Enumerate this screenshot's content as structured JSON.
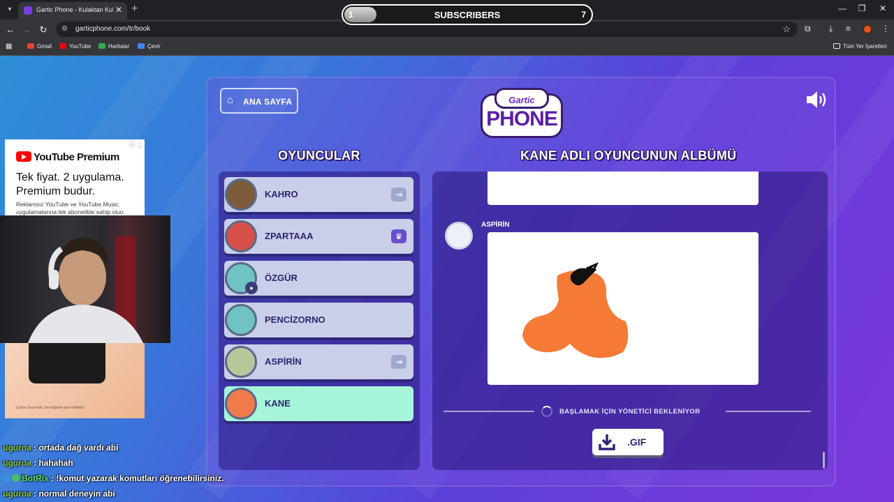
{
  "browser": {
    "tab_title": "Gartic Phone - Kulaktan Kulağa",
    "url": "garticphone.com/tr/book",
    "bookmarks": [
      "Gmail",
      "YouTube",
      "Haritalar",
      "Çevir"
    ],
    "all_bookmarks": "Tüm Yer İşaretleri"
  },
  "subscriber_goal": {
    "start": "1",
    "label": "SUBSCRIBERS",
    "end": "7"
  },
  "game": {
    "home_label": "ANA SAYFA",
    "logo_top": "Gartic",
    "logo_bottom": "PHONE",
    "players_heading": "OYUNCULAR",
    "album_heading": "KANE ADLI OYUNCUNUN ALBÜMÜ",
    "players": [
      {
        "name": "KAHRO",
        "badge": "exit"
      },
      {
        "name": "ZPARTAAA",
        "badge": "crown"
      },
      {
        "name": "ÖZGÜR",
        "badge": ""
      },
      {
        "name": "PENCİZORNO",
        "badge": ""
      },
      {
        "name": "ASPİRİN",
        "badge": "exit"
      },
      {
        "name": "KANE",
        "badge": "",
        "active": true
      }
    ],
    "drawing_author": "ASPİRİN",
    "waiting_text": "BAŞLAMAK İÇİN YÖNETİCİ BEKLENİYOR",
    "gif_label": ".GIF"
  },
  "ad": {
    "brand": "YouTube Premium",
    "headline": "Tek fiyat. 2 uygulama. Premium budur.",
    "body": "Reklamsız YouTube ve YouTube Music uygulamalarına tek abonelikle sahip olun.",
    "footer": "Şartlar Geçerlidir. İstendiğinde iptal edilebilir."
  },
  "chat": [
    {
      "user": "uguroa",
      "message": "ortada dağ vardı abi",
      "bot": false
    },
    {
      "user": "uguroa",
      "message": "hahahah",
      "bot": false
    },
    {
      "user": "BotRix",
      "message": "!komut yazarak komutları öğrenebilirsiniz.",
      "bot": true
    },
    {
      "user": "uguroa",
      "message": "normal deneyin abi",
      "bot": false
    }
  ]
}
